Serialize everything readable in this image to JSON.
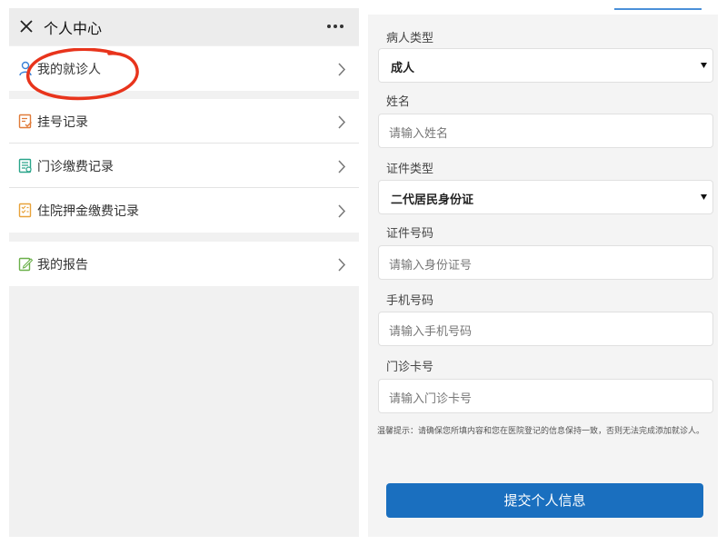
{
  "left": {
    "title": "个人中心",
    "menu_groups": [
      [
        {
          "label": "我的就诊人",
          "icon": "person-icon",
          "color": "#3b82d6"
        }
      ],
      [
        {
          "label": "挂号记录",
          "icon": "register-record-icon",
          "color": "#e07b39"
        },
        {
          "label": "门诊缴费记录",
          "icon": "outpatient-bill-icon",
          "color": "#2aa58a"
        },
        {
          "label": "住院押金缴费记录",
          "icon": "deposit-record-icon",
          "color": "#e8a23a"
        }
      ],
      [
        {
          "label": "我的报告",
          "icon": "report-edit-icon",
          "color": "#6bb04a"
        }
      ]
    ]
  },
  "right": {
    "patient_type": {
      "label": "病人类型",
      "value": "成人"
    },
    "name": {
      "label": "姓名",
      "placeholder": "请输入姓名"
    },
    "id_type": {
      "label": "证件类型",
      "value": "二代居民身份证"
    },
    "id_number": {
      "label": "证件号码",
      "placeholder": "请输入身份证号"
    },
    "phone": {
      "label": "手机号码",
      "placeholder": "请输入手机号码"
    },
    "clinic_card": {
      "label": "门诊卡号",
      "placeholder": "请输入门诊卡号"
    },
    "hint": "温馨提示：请确保您所填内容和您在医院登记的信息保持一致，否则无法完成添加就诊人。",
    "submit_label": "提交个人信息"
  },
  "colors": {
    "accent": "#1a6fbf",
    "annotation": "#e8341c"
  }
}
